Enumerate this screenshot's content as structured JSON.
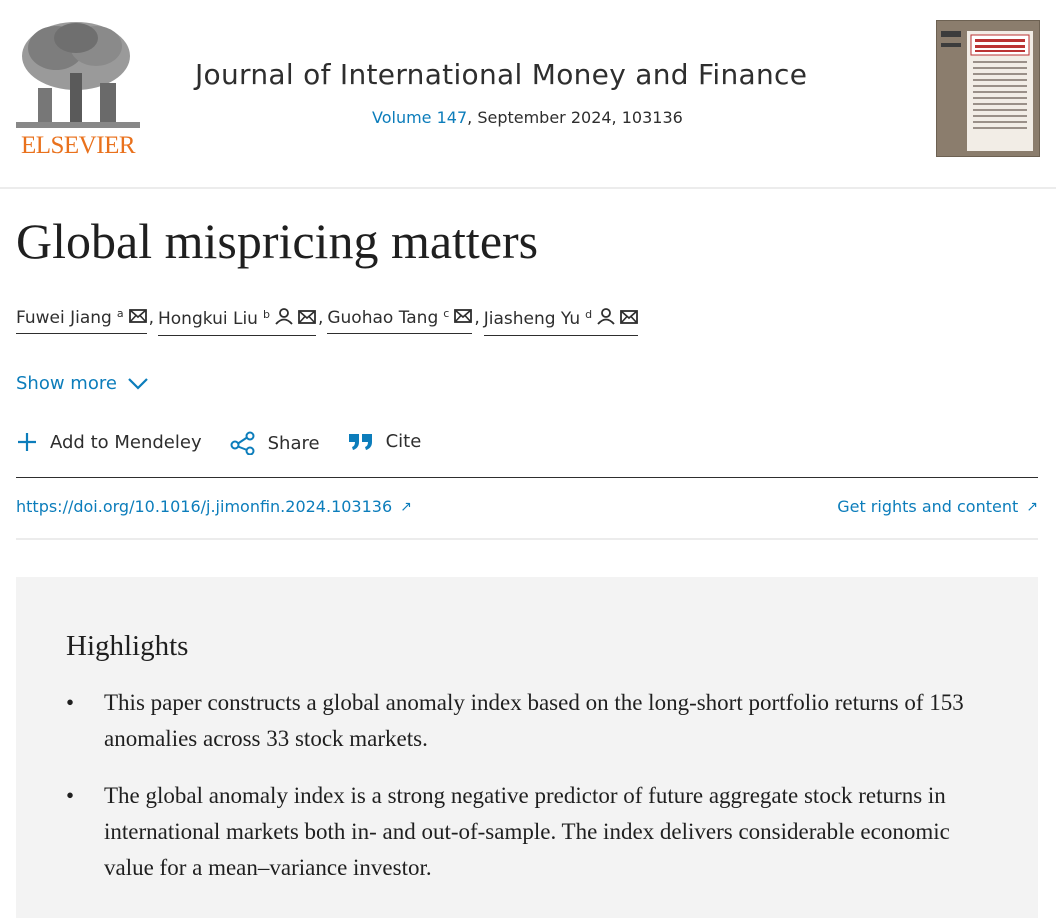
{
  "header": {
    "publisher_logo_text": "ELSEVIER",
    "journal_title": "Journal of International Money and Finance",
    "volume_link": "Volume 147",
    "issue_info": ", September 2024, 103136"
  },
  "article": {
    "title": "Global mispricing matters",
    "authors": [
      {
        "name": "Fuwei Jiang",
        "sup": "a",
        "has_person_icon": false
      },
      {
        "name": "Hongkui Liu",
        "sup": "b",
        "has_person_icon": true
      },
      {
        "name": "Guohao Tang",
        "sup": "c",
        "has_person_icon": false
      },
      {
        "name": "Jiasheng Yu",
        "sup": "d",
        "has_person_icon": true
      }
    ],
    "author_separator": ",",
    "show_more": "Show more"
  },
  "toolbar": {
    "add_mendeley": "Add to Mendeley",
    "share": "Share",
    "cite": "Cite"
  },
  "links": {
    "doi": "https://doi.org/10.1016/j.jimonfin.2024.103136",
    "rights": "Get rights and content",
    "external_arrow": "↗"
  },
  "highlights": {
    "title": "Highlights",
    "bullet": "•",
    "items": [
      "This paper constructs a global anomaly index based on the long-short portfolio returns of 153 anomalies across 33 stock markets.",
      "The global anomaly index is a strong negative predictor of future aggregate stock returns in international markets both in- and out-of-sample. The index delivers considerable economic value for a mean–variance investor."
    ]
  },
  "colors": {
    "link_blue": "#0c7dbb",
    "elsevier_orange": "#e9711c",
    "highlights_bg": "#f3f3f3"
  },
  "icons": [
    "elsevier-tree-logo",
    "journal-cover-thumbnail",
    "mail-icon",
    "person-icon",
    "chevron-down-icon",
    "plus-icon",
    "share-icon",
    "quote-icon",
    "external-link-icon"
  ]
}
